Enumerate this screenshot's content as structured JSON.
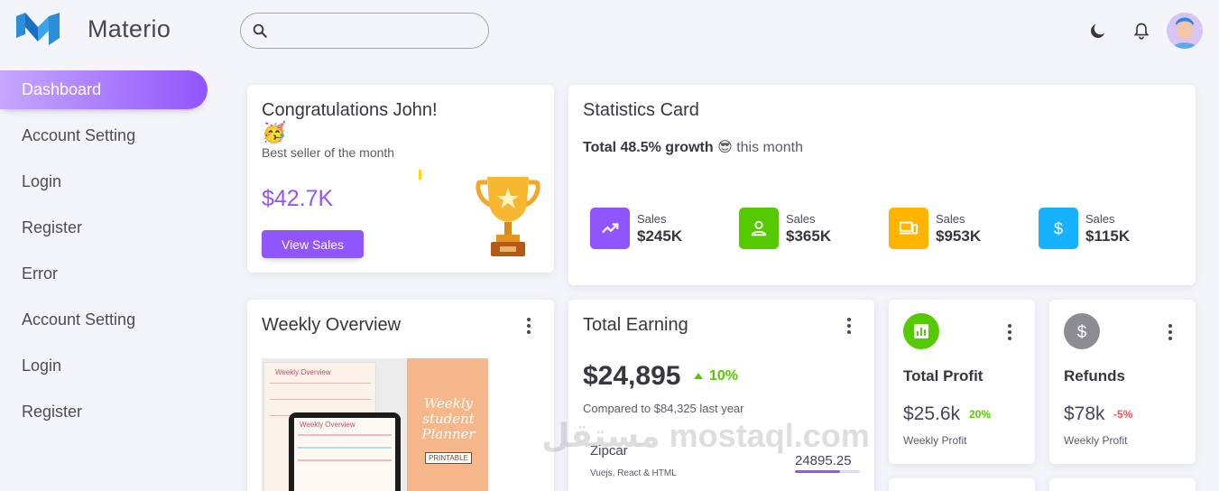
{
  "brand": {
    "name": "Materio"
  },
  "sidebar": {
    "items": [
      {
        "label": "Dashboard",
        "active": true
      },
      {
        "label": "Account Setting"
      },
      {
        "label": "Login"
      },
      {
        "label": "Register"
      },
      {
        "label": "Error"
      },
      {
        "label": "Account Setting"
      },
      {
        "label": "Login"
      },
      {
        "label": "Register"
      }
    ]
  },
  "search": {
    "placeholder": "",
    "value": ""
  },
  "congrats": {
    "title": "Congratulations John!",
    "emoji": "🥳",
    "subtitle": "Best seller of the month",
    "amount": "$42.7K",
    "button_label": "View Sales"
  },
  "statistics": {
    "title": "Statistics Card",
    "growth_bold": "Total 48.5% growth",
    "growth_emoji": "😎",
    "growth_rest": "this month",
    "items": [
      {
        "label": "Sales",
        "value": "$245K",
        "color": "#9155fd",
        "icon": "trending-up-icon"
      },
      {
        "label": "Sales",
        "value": "$365K",
        "color": "#56ca00",
        "icon": "user-icon"
      },
      {
        "label": "Sales",
        "value": "$953K",
        "color": "#ffb400",
        "icon": "devices-icon"
      },
      {
        "label": "Sales",
        "value": "$115K",
        "color": "#16b1ff",
        "icon": "dollar-icon"
      }
    ]
  },
  "weekly": {
    "title": "Weekly Overview",
    "image": {
      "heading": "Weekly Overview",
      "side_text": "Weekly student Planner",
      "tag": "PRINTABLE"
    }
  },
  "earning": {
    "title": "Total Earning",
    "amount": "$24,895",
    "trend": "10%",
    "compare": "Compared to $84,325 last year",
    "row": {
      "name": "Zipcar",
      "desc": "Vuejs, React & HTML",
      "value": "24895.25"
    }
  },
  "profit": {
    "title": "Total Profit",
    "amount": "$25.6k",
    "change": "20%",
    "caption": "Weekly Profit",
    "color": "#56ca00"
  },
  "refunds": {
    "title": "Refunds",
    "amount": "$78k",
    "change": "-5%",
    "caption": "Weekly Profit",
    "color": "#8a8d93"
  },
  "watermark": "مستقل mostaql.com"
}
